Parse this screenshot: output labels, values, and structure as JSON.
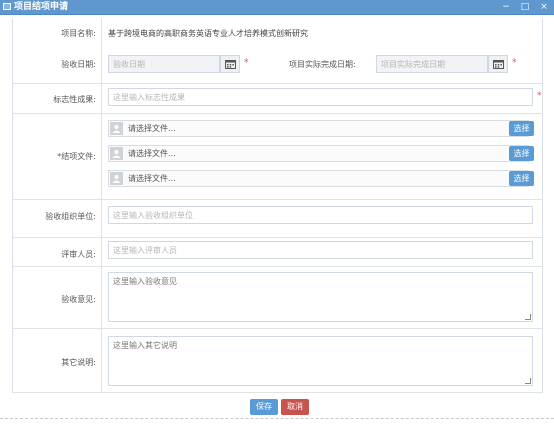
{
  "window": {
    "title": "项目结项申请",
    "controls": [
      "−",
      "□",
      "×"
    ]
  },
  "form": {
    "project_name": {
      "label": "项目名称:",
      "value": "基于跨境电商的高职商务英语专业人才培养模式创新研究"
    },
    "acceptance_date": {
      "label": "验收日期:",
      "placeholder": "验收日期"
    },
    "actual_completion_date": {
      "label": "项目实际完成日期:",
      "placeholder": "项目实际完成日期"
    },
    "landmark_result": {
      "label": "标志性成果:",
      "placeholder": "这里输入标志性成果"
    },
    "closing_files": {
      "label": "*结项文件:",
      "files": [
        {
          "text": "请选择文件...",
          "button": "选择"
        },
        {
          "text": "请选择文件...",
          "button": "选择"
        },
        {
          "text": "请选择文件...",
          "button": "选择"
        }
      ]
    },
    "acceptance_org": {
      "label": "验收组织单位:",
      "placeholder": "这里输入验收组织单位"
    },
    "reviewers": {
      "label": "评审人员:",
      "placeholder": "这里输入评审人员"
    },
    "acceptance_opinion": {
      "label": "验收意见:",
      "placeholder": "这里输入验收意见"
    },
    "other_notes": {
      "label": "其它说明:",
      "placeholder": "这里输入其它说明"
    },
    "required_mark": "*"
  },
  "actions": {
    "save": "保存",
    "cancel": "取消"
  },
  "colors": {
    "titlebar": "#5e98cf",
    "primary_button": "#5b9bd5",
    "danger_button": "#c9534f",
    "required": "#d9534f"
  }
}
